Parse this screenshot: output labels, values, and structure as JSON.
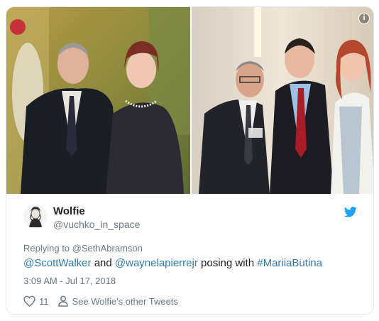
{
  "tweet": {
    "author_name": "Wolfie",
    "author_handle": "@vuchko_in_space",
    "replying_to": "Replying to @SethAbramson",
    "text": {
      "mention1": "@ScottWalker",
      "and": " and ",
      "mention2": "@waynelapierrejr",
      "middle": " posing with ",
      "hashtag": "#MariiaButina"
    },
    "timestamp": "3:09 AM - Jul 17, 2018",
    "like_count": "11",
    "see_more": "See Wolfie's other Tweets"
  },
  "icons": {
    "info": "info-icon",
    "bird": "twitter-bird-icon",
    "like": "heart-icon",
    "profile": "person-icon"
  },
  "colors": {
    "link": "#2b7bb9",
    "muted": "#697882",
    "twitter_blue": "#1da1f2",
    "border": "#e1e8ed"
  }
}
